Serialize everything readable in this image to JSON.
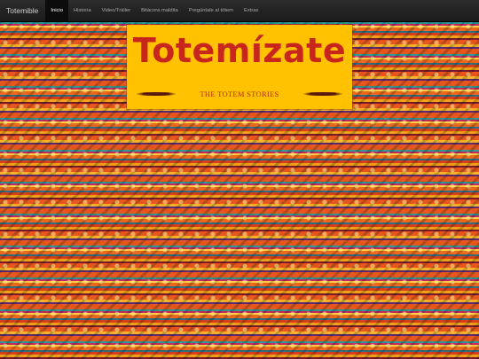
{
  "navbar": {
    "brand": "Totemible",
    "items": [
      {
        "label": "Inicio",
        "active": true
      },
      {
        "label": "Historia"
      },
      {
        "label": "Video/Tráiler"
      },
      {
        "label": "Bitácora maldita"
      },
      {
        "label": "Pregúntale al tótem"
      },
      {
        "label": "Extras"
      }
    ]
  },
  "banner": {
    "title": "Totemízate",
    "subtitle": "THE TOTEM STORIES"
  },
  "colors": {
    "navbar_bg": "#1b1b1b",
    "banner_bg": "#ffc100",
    "title_red": "#c8261c",
    "pattern_orange": "#e8571f"
  }
}
